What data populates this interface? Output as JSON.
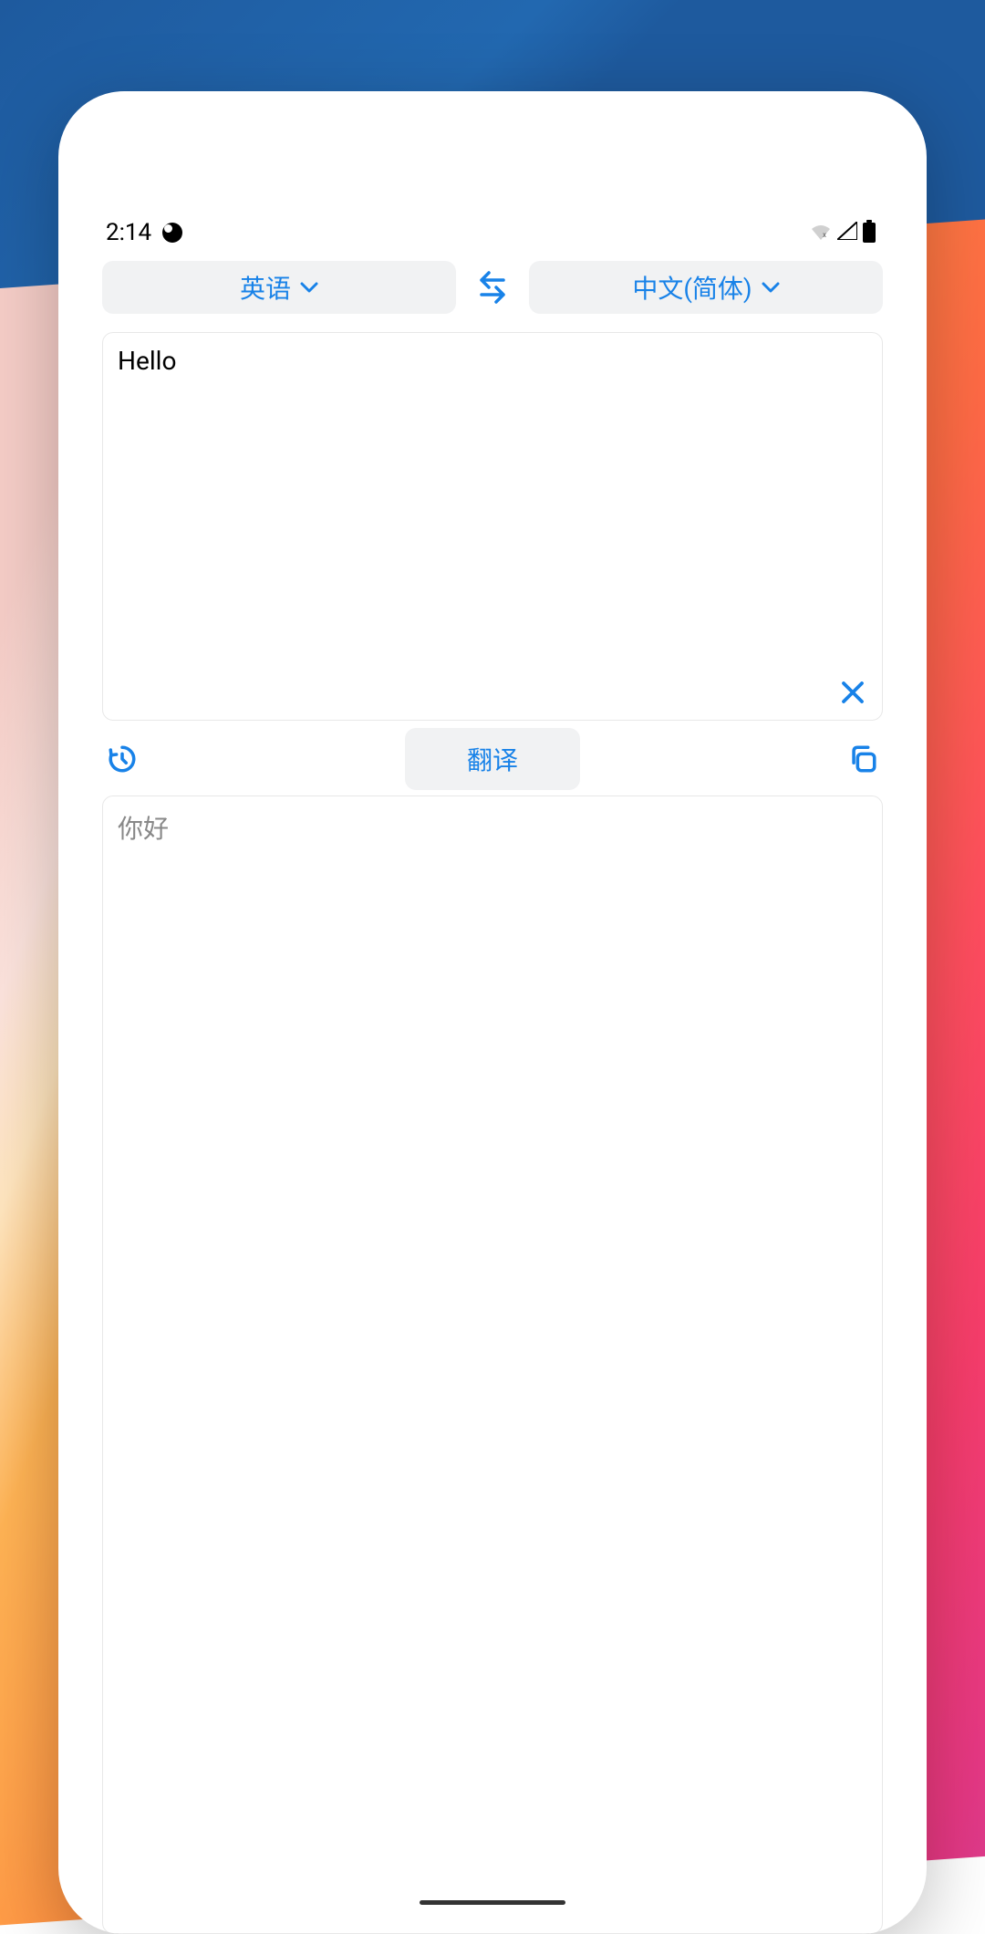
{
  "status": {
    "time": "2:14"
  },
  "languages": {
    "source": "英语",
    "target": "中文(简体)"
  },
  "input": {
    "text": "Hello"
  },
  "output": {
    "text": "你好"
  },
  "actions": {
    "translate": "翻译"
  },
  "colors": {
    "accent": "#1882e8"
  }
}
